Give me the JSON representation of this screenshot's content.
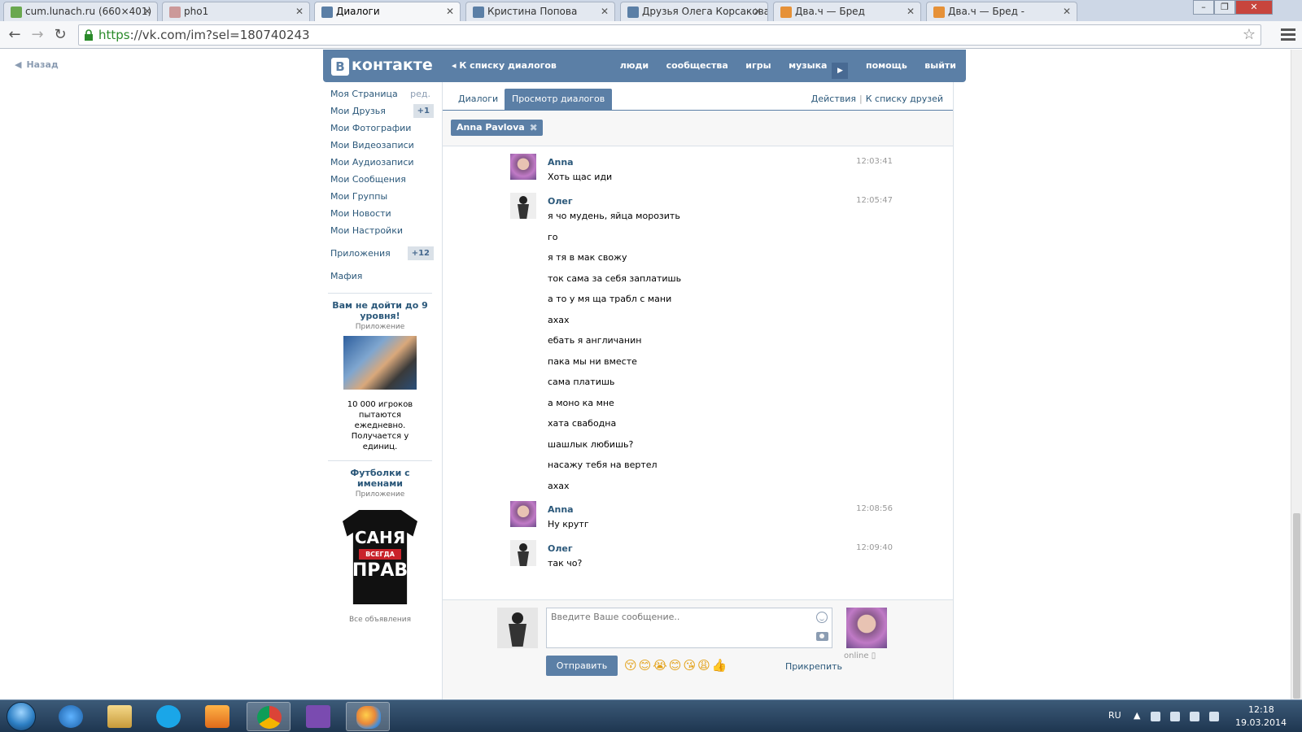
{
  "browser": {
    "tabs": [
      {
        "title": "cum.lunach.ru (660×401)",
        "active": false,
        "icon": "green-circle-icon"
      },
      {
        "title": "pho1",
        "active": false,
        "icon": "bear-icon"
      },
      {
        "title": "Диалоги",
        "active": true,
        "icon": "vk-icon"
      },
      {
        "title": "Кристина Попова",
        "active": false,
        "icon": "vk-icon"
      },
      {
        "title": "Друзья Олега Корсакова",
        "active": false,
        "icon": "vk-icon"
      },
      {
        "title": "Два.ч — Бред",
        "active": false,
        "icon": "lightning-icon"
      },
      {
        "title": "Два.ч — Бред -",
        "active": false,
        "icon": "lightning-icon"
      }
    ],
    "url_scheme": "https",
    "url_rest": "://vk.com/im?sel=180740243"
  },
  "page": {
    "back_label": "Назад"
  },
  "vk_header": {
    "logo_letter": "В",
    "logo_text": "контакте",
    "back_to_list": "К списку диалогов",
    "nav": [
      "люди",
      "сообщества",
      "игры",
      "музыка",
      "помощь",
      "выйти"
    ]
  },
  "sidebar": {
    "items": [
      {
        "label": "Моя Страница",
        "aux": "ред."
      },
      {
        "label": "Мои Друзья",
        "badge": "+1"
      },
      {
        "label": "Мои Фотографии"
      },
      {
        "label": "Мои Видеозаписи"
      },
      {
        "label": "Мои Аудиозаписи"
      },
      {
        "label": "Мои Сообщения"
      },
      {
        "label": "Мои Группы"
      },
      {
        "label": "Мои Новости"
      },
      {
        "label": "Мои Настройки"
      }
    ],
    "apps": {
      "label": "Приложения",
      "badge": "+12"
    },
    "mafia": "Мафия",
    "ad1": {
      "title": "Вам не дойти до 9 уровня!",
      "sub": "Приложение",
      "text": "10 000 игроков пытаются ежедневно. Получается у единиц."
    },
    "ad2": {
      "title": "Футболки с именами",
      "sub": "Приложение",
      "shirt_top": "САНЯ",
      "shirt_mid": "ВСЕГДА",
      "shirt_bot": "ПРАВ"
    },
    "all_ads": "Все объявления"
  },
  "main": {
    "tabs": [
      {
        "label": "Диалоги",
        "active": false
      },
      {
        "label": "Просмотр диалогов",
        "active": true
      }
    ],
    "actions": "Действия",
    "to_friends": "К списку друзей",
    "peer_chip": "Anna Pavlova",
    "messages": [
      {
        "author": "Anna",
        "avatar": "anna",
        "time": "12:03:41",
        "lines": [
          "Хоть щас иди"
        ]
      },
      {
        "author": "Олег",
        "avatar": "oleg",
        "time": "12:05:47",
        "lines": [
          "я чо мудень, яйца морозить",
          "го",
          "я тя в мак свожу",
          "ток сама за себя заплатишь",
          "а то у мя ща трабл с мани",
          "ахах",
          "ебать я англичанин",
          "пака мы ни вместе",
          "сама платишь",
          "а моно ка мне",
          "хата свабодна",
          "шашлык любишь?",
          "насажу тебя на вертел",
          "ахах"
        ]
      },
      {
        "author": "Anna",
        "avatar": "anna",
        "time": "12:08:56",
        "lines": [
          "Ну крутг"
        ]
      },
      {
        "author": "Олег",
        "avatar": "oleg",
        "time": "12:09:40",
        "lines": [
          "так чо?"
        ]
      }
    ],
    "composer": {
      "placeholder": "Введите Ваше сообщение..",
      "send_label": "Отправить",
      "attach_label": "Прикрепить",
      "online_label": "online",
      "emojis": "😚😊😭😊😘😩👍"
    }
  },
  "taskbar": {
    "lang": "RU",
    "time": "12:18",
    "date": "19.03.2014"
  },
  "colors": {
    "vk_blue": "#5b7fa6",
    "link": "#2b587a"
  }
}
